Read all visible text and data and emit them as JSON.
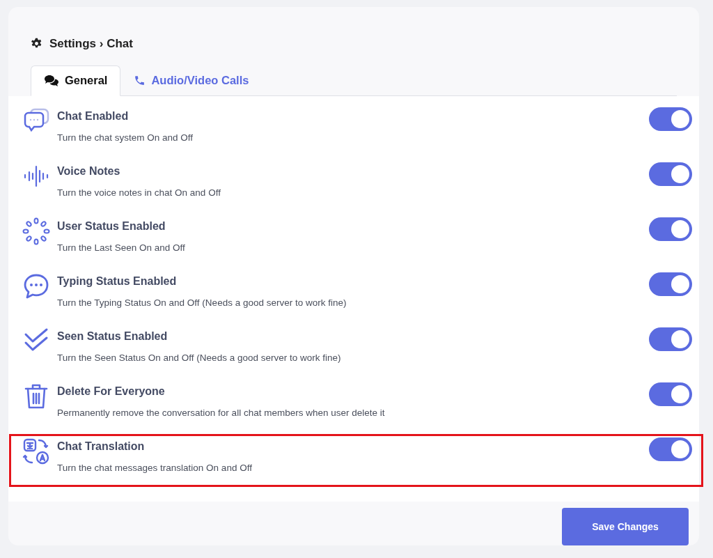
{
  "breadcrumb": {
    "text": "Settings › Chat"
  },
  "tabs": [
    {
      "label": "General",
      "selected": true
    },
    {
      "label": "Audio/Video Calls",
      "selected": false
    }
  ],
  "settings": [
    {
      "title": "Chat Enabled",
      "description": "Turn the chat system On and Off",
      "on": true,
      "highlighted": false
    },
    {
      "title": "Voice Notes",
      "description": "Turn the voice notes in chat On and Off",
      "on": true,
      "highlighted": false
    },
    {
      "title": "User Status Enabled",
      "description": "Turn the Last Seen On and Off",
      "on": true,
      "highlighted": false
    },
    {
      "title": "Typing Status Enabled",
      "description": "Turn the Typing Status On and Off (Needs a good server to work fine)",
      "on": true,
      "highlighted": false
    },
    {
      "title": "Seen Status Enabled",
      "description": "Turn the Seen Status On and Off (Needs a good server to work fine)",
      "on": true,
      "highlighted": false
    },
    {
      "title": "Delete For Everyone",
      "description": "Permanently remove the conversation for all chat members when user delete it",
      "on": true,
      "highlighted": false
    },
    {
      "title": "Chat Translation",
      "description": "Turn the chat messages translation On and Off",
      "on": true,
      "highlighted": true
    }
  ],
  "save_button": "Save Changes"
}
